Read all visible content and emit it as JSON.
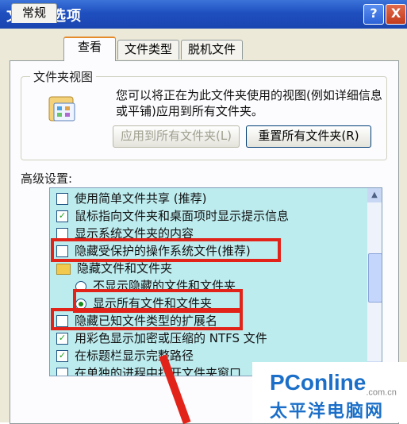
{
  "window": {
    "title": "文件夹选项",
    "help": "?",
    "close": "X"
  },
  "tabs": [
    {
      "label": "常规",
      "active": false
    },
    {
      "label": "查看",
      "active": true
    },
    {
      "label": "文件类型",
      "active": false
    },
    {
      "label": "脱机文件",
      "active": false
    }
  ],
  "folder_view": {
    "group_label": "文件夹视图",
    "description": "您可以将正在为此文件夹使用的视图(例如详细信息或平铺)应用到所有文件夹。",
    "apply_button": "应用到所有文件夹(L)",
    "reset_button": "重置所有文件夹(R)"
  },
  "advanced": {
    "label": "高级设置:",
    "items": [
      {
        "type": "checkbox",
        "checked": false,
        "label": "使用简单文件共享 (推荐)"
      },
      {
        "type": "checkbox",
        "checked": true,
        "label": "鼠标指向文件夹和桌面项时显示提示信息"
      },
      {
        "type": "checkbox",
        "checked": false,
        "label": "显示系统文件夹的内容"
      },
      {
        "type": "checkbox",
        "checked": false,
        "label": "隐藏受保护的操作系统文件(推荐)"
      },
      {
        "type": "folder",
        "label": "隐藏文件和文件夹"
      },
      {
        "type": "radio",
        "checked": false,
        "label": "不显示隐藏的文件和文件夹"
      },
      {
        "type": "radio",
        "checked": true,
        "label": "显示所有文件和文件夹"
      },
      {
        "type": "checkbox",
        "checked": false,
        "label": "隐藏已知文件类型的扩展名"
      },
      {
        "type": "checkbox",
        "checked": true,
        "label": "用彩色显示加密或压缩的 NTFS 文件"
      },
      {
        "type": "checkbox",
        "checked": true,
        "label": "在标题栏显示完整路径"
      },
      {
        "type": "checkbox",
        "checked": false,
        "label": "在单独的进程中打开文件夹窗口"
      }
    ]
  },
  "watermark": {
    "brand": "PConline",
    "domain": ".com.cn",
    "cn": "太平洋电脑网"
  },
  "colors": {
    "highlight": "#e2231a",
    "list_bg": "#bdecef"
  }
}
